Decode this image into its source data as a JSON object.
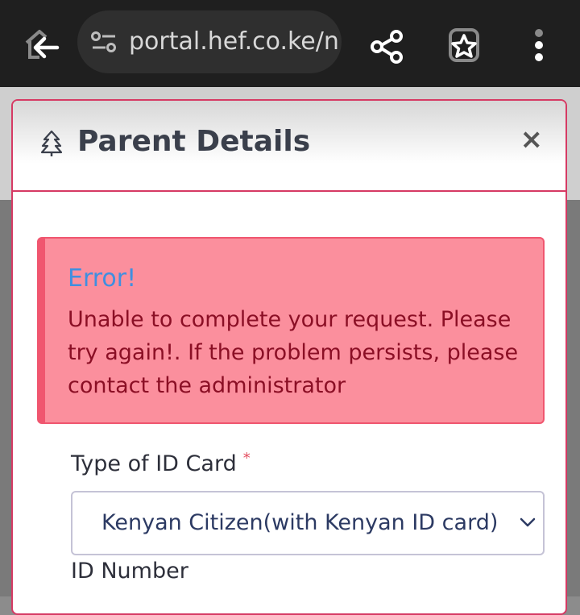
{
  "browser": {
    "url": "portal.hef.co.ke/n",
    "icons": [
      "home-back-icon",
      "site-settings-icon",
      "share-icon",
      "bookmark-star-icon",
      "more-vert-icon"
    ]
  },
  "modal": {
    "title": "Parent Details",
    "close_label": "×",
    "header_icon": "tree-icon"
  },
  "alert": {
    "title": "Error!",
    "message": "Unable to complete your request. Please try again!. If the problem persists, please contact the administrator"
  },
  "form": {
    "id_type_label": "Type of ID Card",
    "required_mark": "*",
    "id_type_value": "Kenyan Citizen(with Kenyan ID card)",
    "id_number_label": "ID Number"
  },
  "colors": {
    "modal_border": "#d63a64",
    "alert_bg": "#fb8f9d",
    "alert_border": "#f0566f",
    "alert_title": "#3f8fe0",
    "alert_text": "#8b0f25"
  }
}
